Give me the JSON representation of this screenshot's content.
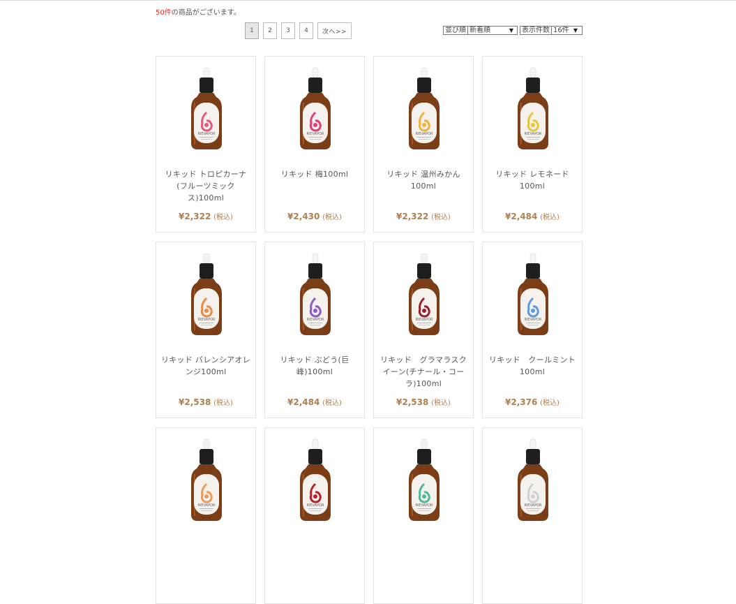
{
  "result": {
    "count": "50件",
    "suffix": "の商品がございます。"
  },
  "pagination": {
    "pages": [
      "1",
      "2",
      "3",
      "4"
    ],
    "current": "1",
    "next_label": "次へ>>"
  },
  "sort": {
    "label": "並び順",
    "value": "新着順"
  },
  "per_page": {
    "label": "表示件数",
    "value": "16件"
  },
  "products": [
    {
      "name": "リキッド トロピカーナ(フルーツミックス)100ml",
      "price": "¥2,322",
      "tax": "(税込)",
      "logo_color": "#e8577e"
    },
    {
      "name": "リキッド 梅100ml",
      "price": "¥2,430",
      "tax": "(税込)",
      "logo_color": "#e23d7a"
    },
    {
      "name": "リキッド 温州みかん100ml",
      "price": "¥2,322",
      "tax": "(税込)",
      "logo_color": "#f0b23c"
    },
    {
      "name": "リキッド レモネード100ml",
      "price": "¥2,484",
      "tax": "(税込)",
      "logo_color": "#e8c537"
    },
    {
      "name": "リキッド バレンシアオレンジ100ml",
      "price": "¥2,538",
      "tax": "(税込)",
      "logo_color": "#ec8a4a"
    },
    {
      "name": "リキッド ぶどう(巨峰)100ml",
      "price": "¥2,484",
      "tax": "(税込)",
      "logo_color": "#8a5bc4"
    },
    {
      "name": "リキッド　グラマラスクイーン(チナール・コーラ)100ml",
      "price": "¥2,538",
      "tax": "(税込)",
      "logo_color": "#9a1f2c"
    },
    {
      "name": "リキッド　クールミント100ml",
      "price": "¥2,376",
      "tax": "(税込)",
      "logo_color": "#5a9be0"
    },
    {
      "name": "",
      "price": "",
      "tax": "",
      "logo_color": "#ec9a5a"
    },
    {
      "name": "",
      "price": "",
      "tax": "",
      "logo_color": "#b8202c"
    },
    {
      "name": "",
      "price": "",
      "tax": "",
      "logo_color": "#4fb89a"
    },
    {
      "name": "",
      "price": "",
      "tax": "",
      "logo_color": "#cfcfcf"
    }
  ],
  "brand_text": "RIEVAPOR"
}
